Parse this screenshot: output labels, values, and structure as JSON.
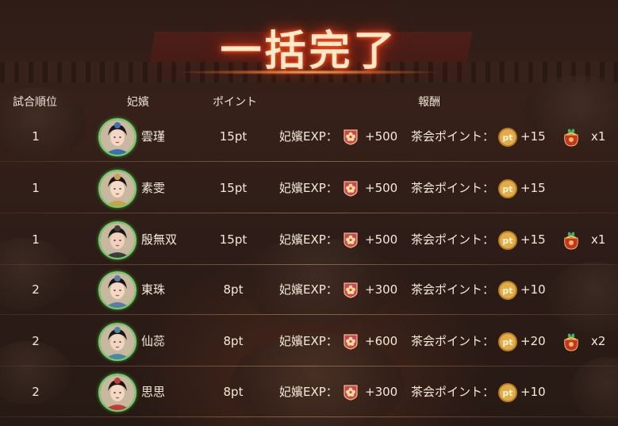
{
  "title": "一括完了",
  "header": {
    "rank": "試合順位",
    "consort": "妃嬪",
    "points": "ポイント",
    "reward": "報酬"
  },
  "exp_label": "妃嬪EXP：",
  "tea_label": "茶会ポイント：",
  "pt_icon_text": "pt",
  "rows": [
    {
      "rank": "1",
      "name": "雲瑾",
      "points": "15pt",
      "exp": "+500",
      "tea": "+15",
      "bag": "x1",
      "avatar": "consort-portrait-1"
    },
    {
      "rank": "1",
      "name": "素雯",
      "points": "15pt",
      "exp": "+500",
      "tea": "+15",
      "bag": "",
      "avatar": "consort-portrait-2"
    },
    {
      "rank": "1",
      "name": "殷無双",
      "points": "15pt",
      "exp": "+500",
      "tea": "+15",
      "bag": "x1",
      "avatar": "consort-portrait-3"
    },
    {
      "rank": "2",
      "name": "東珠",
      "points": "8pt",
      "exp": "+300",
      "tea": "+10",
      "bag": "",
      "avatar": "consort-portrait-4"
    },
    {
      "rank": "2",
      "name": "仙蕊",
      "points": "8pt",
      "exp": "+600",
      "tea": "+20",
      "bag": "x2",
      "avatar": "consort-portrait-5"
    },
    {
      "rank": "2",
      "name": "思思",
      "points": "8pt",
      "exp": "+300",
      "tea": "+10",
      "bag": "",
      "avatar": "consort-portrait-6"
    }
  ],
  "colors": {
    "avatar_ring": "#6fd36a",
    "coin": "#d9a23a",
    "exp_icon": "#c9426a",
    "title_glow": "#e0381a"
  }
}
